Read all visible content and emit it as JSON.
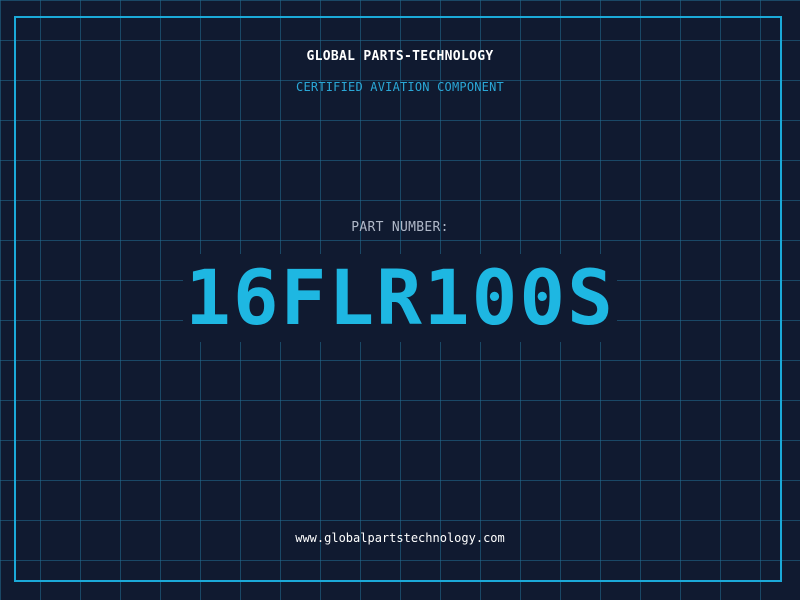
{
  "card": {
    "company": "GLOBAL PARTS-TECHNOLOGY",
    "subtitle": "CERTIFIED AVIATION COMPONENT",
    "part_label": "PART NUMBER:",
    "part_number": "16FLR100S",
    "website": "www.globalpartstechnology.com"
  },
  "colors": {
    "background": "#101a30",
    "grid": "#236e91",
    "frame": "#1ba9d8",
    "accent": "#1eb7e2",
    "subtitle": "#2aa7d6",
    "label": "#b0b8c8",
    "text": "#ffffff"
  }
}
